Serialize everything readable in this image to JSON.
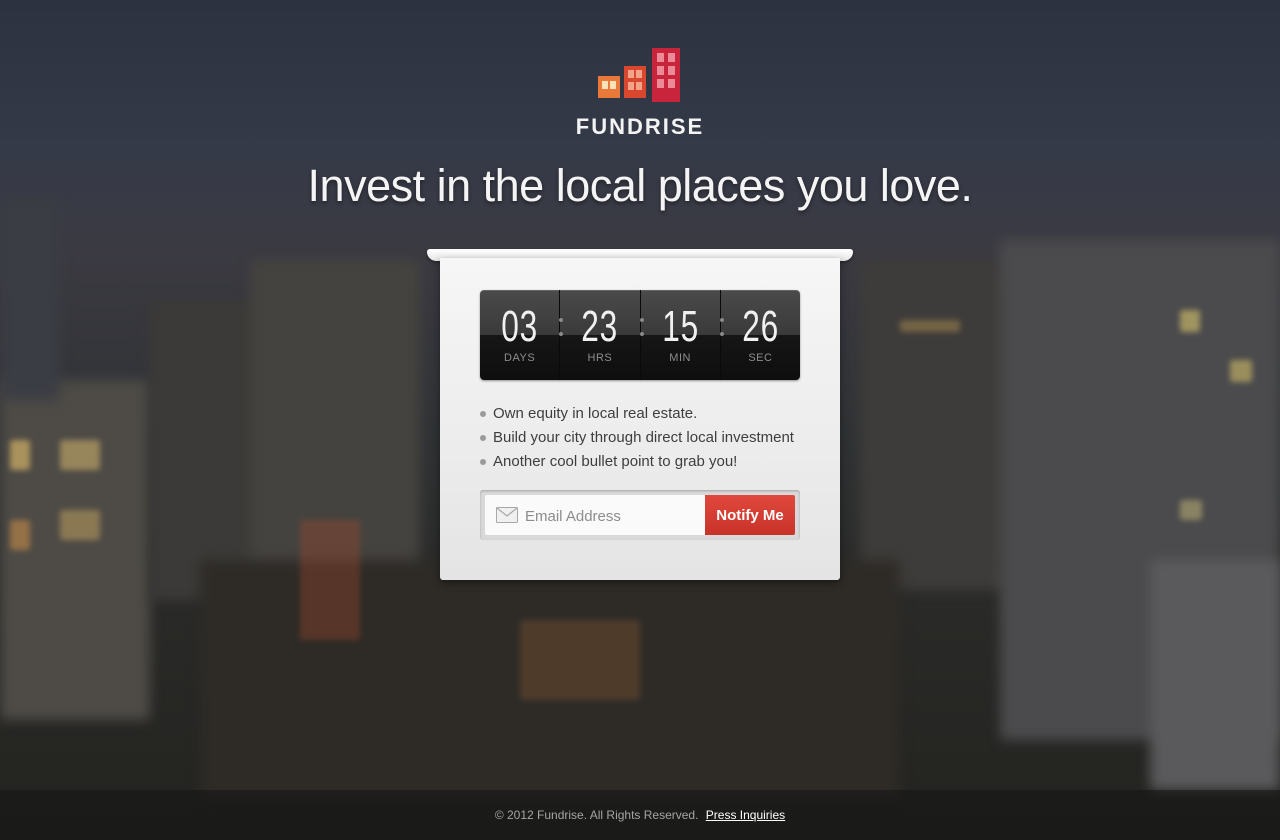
{
  "brand": {
    "name": "FUNDRISE"
  },
  "headline": "Invest in the local places you love.",
  "countdown": {
    "days": {
      "value": "03",
      "label": "DAYS"
    },
    "hours": {
      "value": "23",
      "label": "HRS"
    },
    "minutes": {
      "value": "15",
      "label": "MIN"
    },
    "seconds": {
      "value": "26",
      "label": "SEC"
    }
  },
  "bullets": [
    "Own equity in local real estate.",
    "Build your city through direct local investment",
    "Another cool bullet point to grab you!"
  ],
  "signup": {
    "placeholder": "Email Address",
    "button_label": "Notify Me"
  },
  "footer": {
    "copyright": "© 2012 Fundrise. All Rights Reserved.",
    "press_link": "Press Inquiries"
  },
  "colors": {
    "accent": "#d13b30",
    "logo_orange": "#e8793a",
    "logo_red": "#c8243c"
  }
}
